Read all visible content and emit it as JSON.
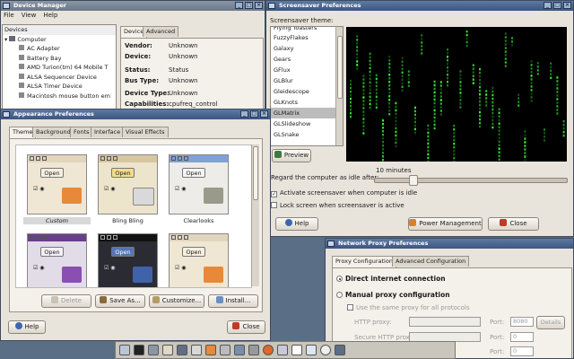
{
  "device_manager": {
    "title": "Device Manager",
    "menu": [
      "File",
      "View",
      "Help"
    ],
    "tree_header": "Devices",
    "tree": [
      "Computer",
      "AC Adapter",
      "Battery Bay",
      "AMD Turion(tm) 64 Mobile T",
      "ALSA Sequencer Device",
      "ALSA Timer Device",
      "Macintosh mouse button em"
    ],
    "tabs": [
      "Device",
      "Advanced"
    ],
    "props": [
      {
        "k": "Vendor:",
        "v": "Unknown"
      },
      {
        "k": "Device:",
        "v": "Unknown"
      },
      {
        "k": "Status:",
        "v": "Status"
      },
      {
        "k": "Bus Type:",
        "v": "Unknown"
      },
      {
        "k": "Device Type:",
        "v": "Unknown"
      },
      {
        "k": "Capabilities:",
        "v": "cpufreq_control"
      }
    ]
  },
  "screensaver": {
    "title": "Screensaver Preferences",
    "theme_label": "Screensaver theme:",
    "themes": [
      "Flying Toasters",
      "FuzzyFlakes",
      "Galaxy",
      "Gears",
      "GFlux",
      "GLBlur",
      "Gleidescope",
      "GLKnots",
      "GLMatrix",
      "GLSlideshow",
      "GLSnake"
    ],
    "selected_theme": "GLMatrix",
    "preview_label": "Preview",
    "idle_label": "Regard the computer as idle after:",
    "idle_value": "10 minutes",
    "activate_label": "Activate screensaver when computer is idle",
    "lock_label": "Lock screen when screensaver is active",
    "help_label": "Help",
    "power_label": "Power Management",
    "close_label": "Close"
  },
  "appearance": {
    "title": "Appearance Preferences",
    "tabs": [
      "Theme",
      "Background",
      "Fonts",
      "Interface",
      "Visual Effects"
    ],
    "open_label": "Open",
    "themes_row1": [
      "Custom",
      "Bling Bling",
      "Clearlooks"
    ],
    "delete_label": "Delete",
    "save_label": "Save As...",
    "customize_label": "Customize...",
    "install_label": "Install...",
    "help_label": "Help",
    "close_label": "Close"
  },
  "proxy": {
    "title": "Network Proxy Preferences",
    "tabs": [
      "Proxy Configuration",
      "Advanced Configuration"
    ],
    "direct_label": "Direct internet connection",
    "manual_label": "Manual proxy configuration",
    "same_proxy_label": "Use the same proxy for all protocols",
    "http_label": "HTTP proxy:",
    "secure_label": "Secure HTTP proxy:",
    "port_label": "Port:",
    "http_port": "8080",
    "port_zero": "0",
    "details_label": "Details"
  },
  "colors": {
    "titlebar": "#3b5680",
    "matrix_green": "#3cff3c",
    "folder_orange": "#e8893a"
  }
}
